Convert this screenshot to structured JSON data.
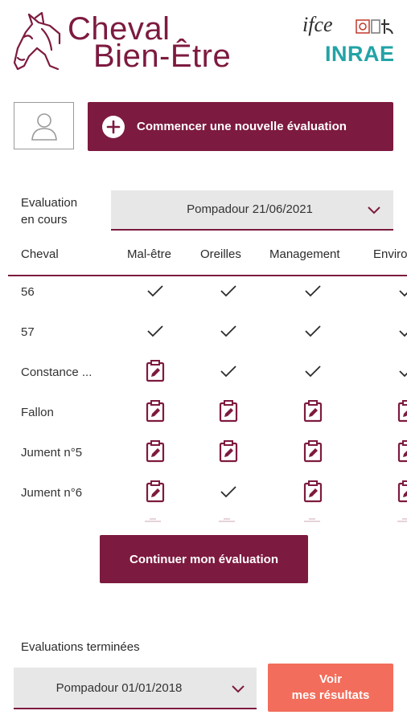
{
  "header": {
    "brand_line1": "Cheval",
    "brand_line2": "Bien-Être",
    "partner_ifce": "ifce",
    "partner_inrae": "INRAE"
  },
  "actions": {
    "start_label": "Commencer une nouvelle évaluation",
    "continue_label": "Continuer mon évaluation"
  },
  "in_progress": {
    "label_line1": "Evaluation",
    "label_line2": "en cours",
    "selected": "Pompadour 21/06/2021"
  },
  "table": {
    "columns": [
      "Cheval",
      "Mal-être",
      "Oreilles",
      "Management",
      "Enviro"
    ],
    "rows": [
      {
        "name": "56",
        "cells": [
          "check",
          "check",
          "check",
          "check"
        ]
      },
      {
        "name": "57",
        "cells": [
          "check",
          "check",
          "check",
          "check"
        ]
      },
      {
        "name": "Constance ...",
        "cells": [
          "edit",
          "check",
          "check",
          "check"
        ]
      },
      {
        "name": "Fallon",
        "cells": [
          "edit",
          "edit",
          "edit",
          "edit"
        ]
      },
      {
        "name": "Jument n°5",
        "cells": [
          "edit",
          "edit",
          "edit",
          "edit"
        ]
      },
      {
        "name": "Jument n°6",
        "cells": [
          "edit",
          "check",
          "edit",
          "edit"
        ]
      }
    ]
  },
  "finished": {
    "label": "Evaluations terminées",
    "selected": "Pompadour 01/01/2018",
    "results_line1": "Voir",
    "results_line2": "mes résultats"
  },
  "colors": {
    "primary": "#7d1a3f",
    "accent": "#f26d5b",
    "inrae": "#22a3a6",
    "select_bg": "#e7e7e7"
  },
  "icons": {
    "done": "check-icon",
    "todo": "clipboard-edit-icon",
    "avatar": "user-icon",
    "add": "plus-circle-icon",
    "dropdown": "chevron-down-icon"
  }
}
